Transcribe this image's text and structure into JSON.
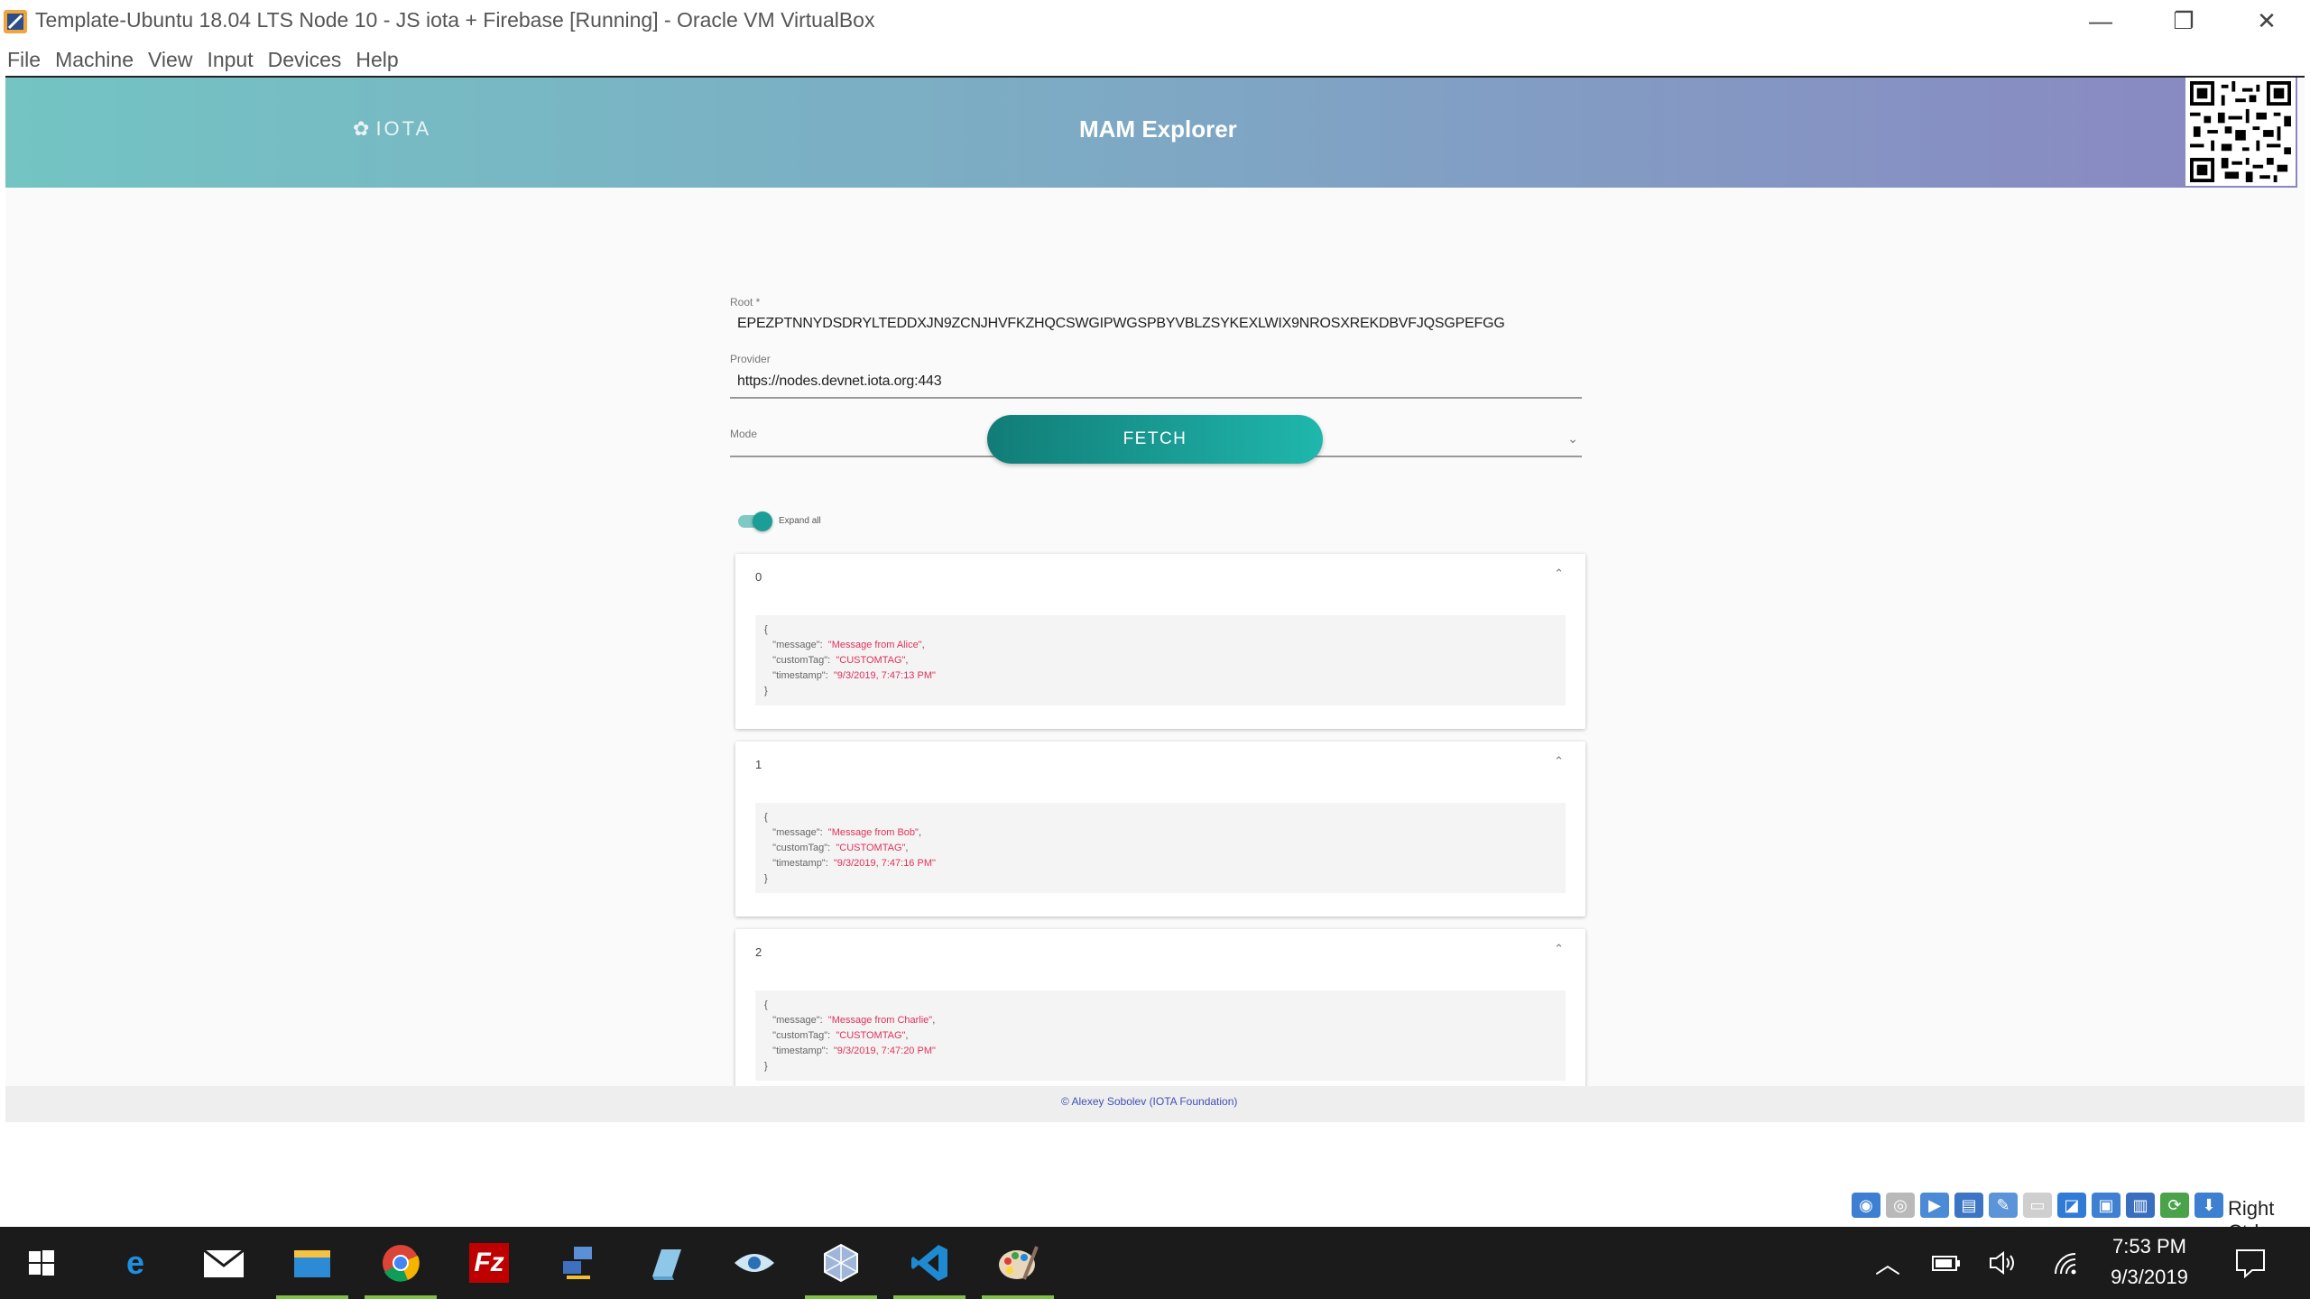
{
  "window": {
    "title": "Template-Ubuntu 18.04 LTS Node 10 - JS iota + Firebase [Running] - Oracle VM VirtualBox",
    "minimize_glyph": "—",
    "maximize_glyph": "❐",
    "close_glyph": "✕"
  },
  "menubar": {
    "items": [
      "File",
      "Machine",
      "View",
      "Input",
      "Devices",
      "Help"
    ]
  },
  "app": {
    "logo_text": "IOTA",
    "title": "MAM Explorer",
    "form": {
      "root_label": "Root *",
      "root_value": "EPEZPTNNYDSDRYLTEDDXJN9ZCNJHVFKZHQCSWGIPWGSPBYVBLZSYKEXLWIX9NROSXREKDBVFJQSGPEFGG",
      "provider_label": "Provider",
      "provider_value": "https://nodes.devnet.iota.org:443",
      "mode_label": "Mode",
      "mode_value": ""
    },
    "fetch_label": "FETCH",
    "expand_all_label": "Expand all",
    "expand_all_on": true,
    "messages": [
      {
        "index": "0",
        "open": "{",
        "close": "}",
        "fields": [
          {
            "key": "\"message\"",
            "value": "\"Message from Alice\"",
            "sep": ","
          },
          {
            "key": "\"customTag\"",
            "value": "\"CUSTOMTAG\"",
            "sep": ","
          },
          {
            "key": "\"timestamp\"",
            "value": "\"9/3/2019, 7:47:13 PM\"",
            "sep": ""
          }
        ]
      },
      {
        "index": "1",
        "open": "{",
        "close": "}",
        "fields": [
          {
            "key": "\"message\"",
            "value": "\"Message from Bob\"",
            "sep": ","
          },
          {
            "key": "\"customTag\"",
            "value": "\"CUSTOMTAG\"",
            "sep": ","
          },
          {
            "key": "\"timestamp\"",
            "value": "\"9/3/2019, 7:47:16 PM\"",
            "sep": ""
          }
        ]
      },
      {
        "index": "2",
        "open": "{",
        "close": "}",
        "fields": [
          {
            "key": "\"message\"",
            "value": "\"Message from Charlie\"",
            "sep": ","
          },
          {
            "key": "\"customTag\"",
            "value": "\"CUSTOMTAG\"",
            "sep": ","
          },
          {
            "key": "\"timestamp\"",
            "value": "\"9/3/2019, 7:47:20 PM\"",
            "sep": ""
          }
        ]
      }
    ],
    "footer": "© Alexey Sobolev (IOTA Foundation)"
  },
  "statusbar": {
    "host_key": "Right Ctrl"
  },
  "taskbar": {
    "clock_time": "7:53 PM",
    "clock_date": "9/3/2019"
  },
  "colors": {
    "accent": "#1a9e96",
    "json_string": "#e0315a",
    "footer_link": "#3f51b5"
  }
}
